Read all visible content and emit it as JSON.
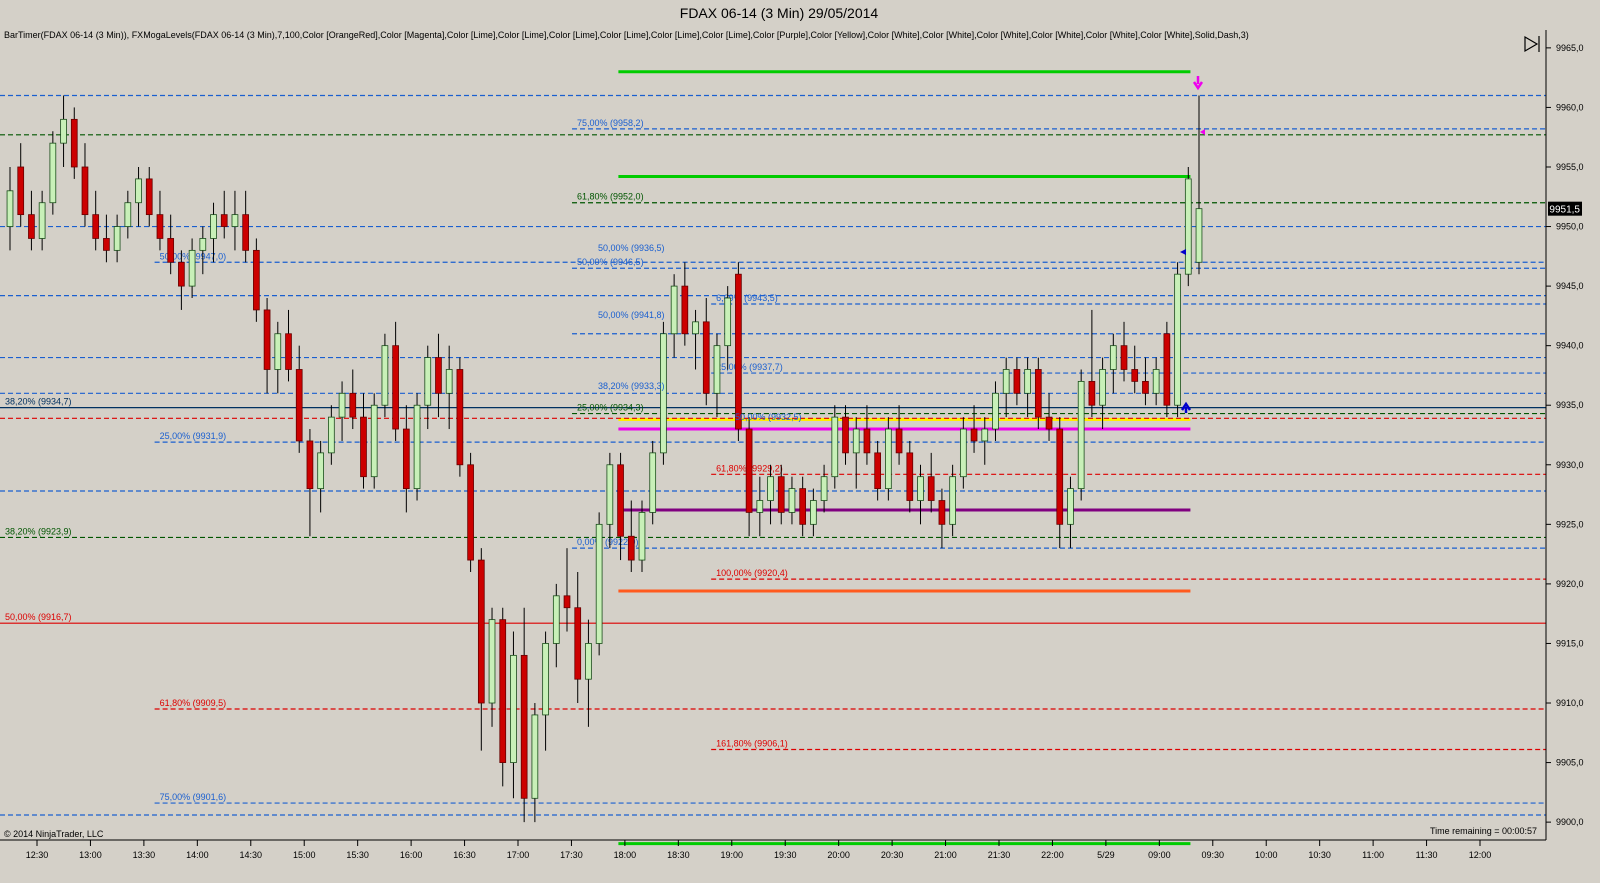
{
  "window": {
    "title": "FDAX 06-14 (3 Min)  29/05/2014"
  },
  "indicator_text": "BarTimer(FDAX 06-14 (3 Min)), FXMogaLevels(FDAX 06-14 (3 Min),7,100,Color [OrangeRed],Color [Magenta],Color [Lime],Color [Lime],Color [Lime],Color [Lime],Color [Lime],Color [Lime],Color [Purple],Color [Yellow],Color [White],Color [White],Color [White],Color [White],Color [White],Color [White],Solid,Dash,3)",
  "copyright": "© 2014 NinjaTrader, LLC",
  "time_remaining": "Time remaining = 00:00:57",
  "last_price": "9951,5",
  "colors": {
    "background": "#d4d0c8",
    "up_candle": "#c8f0b8",
    "down_candle": "#cc0000",
    "wick": "#000000",
    "lime": "#00cc00",
    "orange_red": "#ff5a1e",
    "magenta": "#ee00ee",
    "purple": "#800080",
    "yellow": "#ffee00",
    "blue_dash": "#1a5fd0",
    "red_dash": "#dd0000",
    "green_dash": "#005500",
    "navy": "#003060"
  },
  "chart_data": {
    "type": "candlestick",
    "title": "FDAX 06-14 (3 Min)  29/05/2014",
    "ylim": [
      9898.5,
      9966.5
    ],
    "y_ticks": [
      9900,
      9905,
      9910,
      9915,
      9920,
      9925,
      9930,
      9935,
      9940,
      9945,
      9950,
      9955,
      9960,
      9965
    ],
    "y_tick_labels": [
      "9900,0",
      "9905,0",
      "9910,0",
      "9915,0",
      "9920,0",
      "9925,0",
      "9930,0",
      "9935,0",
      "9940,0",
      "9945,0",
      "9950,0",
      "9955,0",
      "9960,0",
      "9965,0"
    ],
    "x_tick_labels": [
      "12:30",
      "13:00",
      "13:30",
      "14:00",
      "14:30",
      "15:00",
      "15:30",
      "16:00",
      "16:30",
      "17:00",
      "17:30",
      "18:00",
      "18:30",
      "19:00",
      "19:30",
      "20:00",
      "20:30",
      "21:00",
      "21:30",
      "22:00",
      "5/29",
      "09:00",
      "09:30",
      "10:00",
      "10:30",
      "11:00",
      "11:30",
      "12:00"
    ],
    "candles": [
      {
        "x": 0,
        "o": 9950,
        "h": 9955,
        "l": 9948,
        "c": 9953
      },
      {
        "x": 1,
        "o": 9955,
        "h": 9957,
        "l": 9950,
        "c": 9951
      },
      {
        "x": 2,
        "o": 9951,
        "h": 9953,
        "l": 9948,
        "c": 9949
      },
      {
        "x": 3,
        "o": 9949,
        "h": 9953,
        "l": 9948,
        "c": 9952
      },
      {
        "x": 4,
        "o": 9952,
        "h": 9958,
        "l": 9951,
        "c": 9957
      },
      {
        "x": 5,
        "o": 9957,
        "h": 9961,
        "l": 9955,
        "c": 9959
      },
      {
        "x": 6,
        "o": 9959,
        "h": 9960,
        "l": 9954,
        "c": 9955
      },
      {
        "x": 7,
        "o": 9955,
        "h": 9957,
        "l": 9950,
        "c": 9951
      },
      {
        "x": 8,
        "o": 9951,
        "h": 9953,
        "l": 9948,
        "c": 9949
      },
      {
        "x": 9,
        "o": 9949,
        "h": 9951,
        "l": 9947,
        "c": 9948
      },
      {
        "x": 10,
        "o": 9948,
        "h": 9951,
        "l": 9947,
        "c": 9950
      },
      {
        "x": 11,
        "o": 9950,
        "h": 9953,
        "l": 9949,
        "c": 9952
      },
      {
        "x": 12,
        "o": 9952,
        "h": 9955,
        "l": 9950,
        "c": 9954
      },
      {
        "x": 13,
        "o": 9954,
        "h": 9955,
        "l": 9950,
        "c": 9951
      },
      {
        "x": 14,
        "o": 9951,
        "h": 9953,
        "l": 9948,
        "c": 9949
      },
      {
        "x": 15,
        "o": 9949,
        "h": 9951,
        "l": 9946,
        "c": 9947
      },
      {
        "x": 16,
        "o": 9947,
        "h": 9948,
        "l": 9943,
        "c": 9945
      },
      {
        "x": 17,
        "o": 9945,
        "h": 9949,
        "l": 9944,
        "c": 9948
      },
      {
        "x": 18,
        "o": 9948,
        "h": 9950,
        "l": 9946,
        "c": 9949
      },
      {
        "x": 19,
        "o": 9949,
        "h": 9952,
        "l": 9947,
        "c": 9951
      },
      {
        "x": 20,
        "o": 9951,
        "h": 9953,
        "l": 9949,
        "c": 9950
      },
      {
        "x": 21,
        "o": 9950,
        "h": 9953,
        "l": 9948,
        "c": 9951
      },
      {
        "x": 22,
        "o": 9951,
        "h": 9953,
        "l": 9947,
        "c": 9948
      },
      {
        "x": 23,
        "o": 9948,
        "h": 9949,
        "l": 9942,
        "c": 9943
      },
      {
        "x": 24,
        "o": 9943,
        "h": 9944,
        "l": 9936,
        "c": 9938
      },
      {
        "x": 25,
        "o": 9938,
        "h": 9942,
        "l": 9936,
        "c": 9941
      },
      {
        "x": 26,
        "o": 9941,
        "h": 9943,
        "l": 9937,
        "c": 9938
      },
      {
        "x": 27,
        "o": 9938,
        "h": 9940,
        "l": 9931,
        "c": 9932
      },
      {
        "x": 28,
        "o": 9932,
        "h": 9933,
        "l": 9924,
        "c": 9928
      },
      {
        "x": 29,
        "o": 9928,
        "h": 9932,
        "l": 9926,
        "c": 9931
      },
      {
        "x": 30,
        "o": 9931,
        "h": 9935,
        "l": 9930,
        "c": 9934
      },
      {
        "x": 31,
        "o": 9934,
        "h": 9937,
        "l": 9932,
        "c": 9936
      },
      {
        "x": 32,
        "o": 9936,
        "h": 9938,
        "l": 9933,
        "c": 9934
      },
      {
        "x": 33,
        "o": 9934,
        "h": 9936,
        "l": 9928,
        "c": 9929
      },
      {
        "x": 34,
        "o": 9929,
        "h": 9936,
        "l": 9928,
        "c": 9935
      },
      {
        "x": 35,
        "o": 9935,
        "h": 9941,
        "l": 9934,
        "c": 9940
      },
      {
        "x": 36,
        "o": 9940,
        "h": 9942,
        "l": 9932,
        "c": 9933
      },
      {
        "x": 37,
        "o": 9933,
        "h": 9935,
        "l": 9926,
        "c": 9928
      },
      {
        "x": 38,
        "o": 9928,
        "h": 9936,
        "l": 9927,
        "c": 9935
      },
      {
        "x": 39,
        "o": 9935,
        "h": 9940,
        "l": 9933,
        "c": 9939
      },
      {
        "x": 40,
        "o": 9939,
        "h": 9941,
        "l": 9934,
        "c": 9936
      },
      {
        "x": 41,
        "o": 9936,
        "h": 9940,
        "l": 9933,
        "c": 9938
      },
      {
        "x": 42,
        "o": 9938,
        "h": 9939,
        "l": 9929,
        "c": 9930
      },
      {
        "x": 43,
        "o": 9930,
        "h": 9931,
        "l": 9921,
        "c": 9922
      },
      {
        "x": 44,
        "o": 9922,
        "h": 9923,
        "l": 9906,
        "c": 9910
      },
      {
        "x": 45,
        "o": 9910,
        "h": 9918,
        "l": 9908,
        "c": 9917
      },
      {
        "x": 46,
        "o": 9917,
        "h": 9918,
        "l": 9903,
        "c": 9905
      },
      {
        "x": 47,
        "o": 9905,
        "h": 9916,
        "l": 9902,
        "c": 9914
      },
      {
        "x": 48,
        "o": 9914,
        "h": 9918,
        "l": 9900,
        "c": 9902
      },
      {
        "x": 49,
        "o": 9902,
        "h": 9910,
        "l": 9900,
        "c": 9909
      },
      {
        "x": 50,
        "o": 9909,
        "h": 9916,
        "l": 9906,
        "c": 9915
      },
      {
        "x": 51,
        "o": 9915,
        "h": 9920,
        "l": 9913,
        "c": 9919
      },
      {
        "x": 52,
        "o": 9919,
        "h": 9923,
        "l": 9916,
        "c": 9918
      },
      {
        "x": 53,
        "o": 9918,
        "h": 9921,
        "l": 9910,
        "c": 9912
      },
      {
        "x": 54,
        "o": 9912,
        "h": 9917,
        "l": 9908,
        "c": 9915
      },
      {
        "x": 55,
        "o": 9915,
        "h": 9926,
        "l": 9914,
        "c": 9925
      },
      {
        "x": 56,
        "o": 9925,
        "h": 9931,
        "l": 9923,
        "c": 9930
      },
      {
        "x": 57,
        "o": 9930,
        "h": 9931,
        "l": 9922,
        "c": 9924
      },
      {
        "x": 58,
        "o": 9924,
        "h": 9927,
        "l": 9921,
        "c": 9922
      },
      {
        "x": 59,
        "o": 9922,
        "h": 9927,
        "l": 9921,
        "c": 9926
      },
      {
        "x": 60,
        "o": 9926,
        "h": 9932,
        "l": 9925,
        "c": 9931
      },
      {
        "x": 61,
        "o": 9931,
        "h": 9942,
        "l": 9930,
        "c": 9941
      },
      {
        "x": 62,
        "o": 9941,
        "h": 9946,
        "l": 9939,
        "c": 9945
      },
      {
        "x": 63,
        "o": 9945,
        "h": 9947,
        "l": 9940,
        "c": 9941
      },
      {
        "x": 64,
        "o": 9941,
        "h": 9943,
        "l": 9938,
        "c": 9942
      },
      {
        "x": 65,
        "o": 9942,
        "h": 9944,
        "l": 9935,
        "c": 9936
      },
      {
        "x": 66,
        "o": 9936,
        "h": 9941,
        "l": 9934,
        "c": 9940
      },
      {
        "x": 67,
        "o": 9940,
        "h": 9945,
        "l": 9938,
        "c": 9944
      },
      {
        "x": 68,
        "o": 9946,
        "h": 9947,
        "l": 9932,
        "c": 9933
      },
      {
        "x": 69,
        "o": 9933,
        "h": 9934,
        "l": 9924,
        "c": 9926
      },
      {
        "x": 70,
        "o": 9926,
        "h": 9929,
        "l": 9924,
        "c": 9927
      },
      {
        "x": 71,
        "o": 9927,
        "h": 9930,
        "l": 9925,
        "c": 9929
      },
      {
        "x": 72,
        "o": 9929,
        "h": 9930,
        "l": 9925,
        "c": 9926
      },
      {
        "x": 73,
        "o": 9926,
        "h": 9929,
        "l": 9925,
        "c": 9928
      },
      {
        "x": 74,
        "o": 9928,
        "h": 9929,
        "l": 9924,
        "c": 9925
      },
      {
        "x": 75,
        "o": 9925,
        "h": 9928,
        "l": 9924,
        "c": 9927
      },
      {
        "x": 76,
        "o": 9927,
        "h": 9930,
        "l": 9926,
        "c": 9929
      },
      {
        "x": 77,
        "o": 9929,
        "h": 9935,
        "l": 9928,
        "c": 9934
      },
      {
        "x": 78,
        "o": 9934,
        "h": 9935,
        "l": 9930,
        "c": 9931
      },
      {
        "x": 79,
        "o": 9931,
        "h": 9934,
        "l": 9928,
        "c": 9933
      },
      {
        "x": 80,
        "o": 9933,
        "h": 9935,
        "l": 9930,
        "c": 9931
      },
      {
        "x": 81,
        "o": 9931,
        "h": 9932,
        "l": 9927,
        "c": 9928
      },
      {
        "x": 82,
        "o": 9928,
        "h": 9934,
        "l": 9927,
        "c": 9933
      },
      {
        "x": 83,
        "o": 9933,
        "h": 9935,
        "l": 9930,
        "c": 9931
      },
      {
        "x": 84,
        "o": 9931,
        "h": 9932,
        "l": 9926,
        "c": 9927
      },
      {
        "x": 85,
        "o": 9927,
        "h": 9930,
        "l": 9925,
        "c": 9929
      },
      {
        "x": 86,
        "o": 9929,
        "h": 9931,
        "l": 9926,
        "c": 9927
      },
      {
        "x": 87,
        "o": 9927,
        "h": 9928,
        "l": 9923,
        "c": 9925
      },
      {
        "x": 88,
        "o": 9925,
        "h": 9930,
        "l": 9924,
        "c": 9929
      },
      {
        "x": 89,
        "o": 9929,
        "h": 9934,
        "l": 9928,
        "c": 9933
      },
      {
        "x": 90,
        "o": 9933,
        "h": 9935,
        "l": 9931,
        "c": 9932
      },
      {
        "x": 91,
        "o": 9932,
        "h": 9934,
        "l": 9930,
        "c": 9933
      },
      {
        "x": 92,
        "o": 9933,
        "h": 9937,
        "l": 9932,
        "c": 9936
      },
      {
        "x": 93,
        "o": 9936,
        "h": 9939,
        "l": 9934,
        "c": 9938
      },
      {
        "x": 94,
        "o": 9938,
        "h": 9939,
        "l": 9935,
        "c": 9936
      },
      {
        "x": 95,
        "o": 9936,
        "h": 9939,
        "l": 9934,
        "c": 9938
      },
      {
        "x": 96,
        "o": 9938,
        "h": 9939,
        "l": 9933,
        "c": 9934
      },
      {
        "x": 97,
        "o": 9934,
        "h": 9936,
        "l": 9932,
        "c": 9933
      },
      {
        "x": 98,
        "o": 9933,
        "h": 9934,
        "l": 9923,
        "c": 9925
      },
      {
        "x": 99,
        "o": 9925,
        "h": 9929,
        "l": 9923,
        "c": 9928
      },
      {
        "x": 100,
        "o": 9928,
        "h": 9938,
        "l": 9927,
        "c": 9937
      },
      {
        "x": 101,
        "o": 9937,
        "h": 9943,
        "l": 9934,
        "c": 9935
      },
      {
        "x": 102,
        "o": 9935,
        "h": 9939,
        "l": 9933,
        "c": 9938
      },
      {
        "x": 103,
        "o": 9938,
        "h": 9941,
        "l": 9936,
        "c": 9940
      },
      {
        "x": 104,
        "o": 9940,
        "h": 9942,
        "l": 9937,
        "c": 9938
      },
      {
        "x": 105,
        "o": 9938,
        "h": 9940,
        "l": 9936,
        "c": 9937
      },
      {
        "x": 106,
        "o": 9937,
        "h": 9939,
        "l": 9935,
        "c": 9936
      },
      {
        "x": 107,
        "o": 9936,
        "h": 9939,
        "l": 9935,
        "c": 9938
      },
      {
        "x": 108,
        "o": 9941,
        "h": 9942,
        "l": 9934,
        "c": 9935
      },
      {
        "x": 109,
        "o": 9935,
        "h": 9947,
        "l": 9934,
        "c": 9946
      },
      {
        "x": 110,
        "o": 9946,
        "h": 9955,
        "l": 9945,
        "c": 9954
      },
      {
        "x": 111,
        "o": 9947,
        "h": 9961,
        "l": 9946,
        "c": 9951.5
      }
    ],
    "levels": [
      {
        "price": 9963,
        "label": "",
        "style": "solid",
        "color": "lime",
        "from": 0.4,
        "to": 0.77
      },
      {
        "price": 9954.2,
        "label": "",
        "style": "solid",
        "color": "lime",
        "from": 0.4,
        "to": 0.77
      },
      {
        "price": 9898.2,
        "label": "",
        "style": "solid",
        "color": "lime",
        "from": 0.4,
        "to": 0.77
      },
      {
        "price": 9919.4,
        "label": "",
        "style": "solid",
        "color": "orange_red",
        "from": 0.4,
        "to": 0.77
      },
      {
        "price": 9933.0,
        "label": "",
        "style": "solid",
        "color": "magenta",
        "from": 0.4,
        "to": 0.77
      },
      {
        "price": 9933.8,
        "label": "",
        "style": "solid",
        "color": "yellow",
        "from": 0.4,
        "to": 0.77
      },
      {
        "price": 9926.2,
        "label": "",
        "style": "solid",
        "color": "purple",
        "from": 0.4,
        "to": 0.77
      },
      {
        "price": 9916.7,
        "label": "50,00% (9916,7)",
        "style": "solid",
        "color": "red_dash",
        "from": 0.0,
        "to": 1.0
      },
      {
        "price": 9934.8,
        "label": "38,20% (9934,7)",
        "style": "solid",
        "color": "navy",
        "from": 0.0,
        "to": 1.0
      },
      {
        "price": 9961.0,
        "label": "",
        "style": "dash",
        "color": "blue_dash",
        "from": 0.0,
        "to": 1.0
      },
      {
        "price": 9958.2,
        "label": "75,00% (9958,2)",
        "style": "dash",
        "color": "blue_dash",
        "from": 0.37,
        "to": 1.0
      },
      {
        "price": 9957.7,
        "label": "",
        "style": "dash",
        "color": "green_dash",
        "from": 0.0,
        "to": 1.0
      },
      {
        "price": 9952.0,
        "label": "61,80% (9952,0)",
        "style": "dash",
        "color": "green_dash",
        "from": 0.37,
        "to": 1.0
      },
      {
        "price": 9950.0,
        "label": "",
        "style": "dash",
        "color": "blue_dash",
        "from": 0.0,
        "to": 1.0
      },
      {
        "price": 9947.0,
        "label": "50,00% (9947,0)",
        "style": "dash",
        "color": "blue_dash",
        "from": 0.1,
        "to": 1.0
      },
      {
        "price": 9946.5,
        "label": "50,00% (9946,5)",
        "style": "dash",
        "color": "blue_dash",
        "from": 0.37,
        "to": 1.0
      },
      {
        "price": 9944.2,
        "label": "",
        "style": "dash",
        "color": "blue_dash",
        "from": 0.0,
        "to": 1.0
      },
      {
        "price": 9943.5,
        "label": "6,69% (9943,5)",
        "style": "dash",
        "color": "blue_dash",
        "from": 0.46,
        "to": 1.0
      },
      {
        "price": 9941.0,
        "label": "",
        "style": "dash",
        "color": "blue_dash",
        "from": 0.37,
        "to": 1.0
      },
      {
        "price": 9939.0,
        "label": "",
        "style": "dash",
        "color": "blue_dash",
        "from": 0.0,
        "to": 1.0
      },
      {
        "price": 9937.7,
        "label": "25,00% (9937,7)",
        "style": "dash",
        "color": "blue_dash",
        "from": 0.46,
        "to": 1.0
      },
      {
        "price": 9936.0,
        "label": "",
        "style": "dash",
        "color": "blue_dash",
        "from": 0.0,
        "to": 1.0
      },
      {
        "price": 9934.3,
        "label": "25,00% (9934,3)",
        "style": "dash",
        "color": "green_dash",
        "from": 0.37,
        "to": 1.0
      },
      {
        "price": 9933.9,
        "label": "",
        "style": "dash",
        "color": "red_dash",
        "from": 0.0,
        "to": 1.0
      },
      {
        "price": 9931.9,
        "label": "25,00% (9931,9)",
        "style": "dash",
        "color": "blue_dash",
        "from": 0.1,
        "to": 1.0
      },
      {
        "price": 9929.2,
        "label": "61,80% (9929,2)",
        "style": "dash",
        "color": "red_dash",
        "from": 0.46,
        "to": 1.0
      },
      {
        "price": 9927.8,
        "label": "",
        "style": "dash",
        "color": "blue_dash",
        "from": 0.0,
        "to": 1.0
      },
      {
        "price": 9923.9,
        "label": "38,20% (9923,9)",
        "style": "dash",
        "color": "green_dash",
        "from": 0.0,
        "to": 1.0
      },
      {
        "price": 9923.0,
        "label": "0,00% (9922,9)",
        "style": "dash",
        "color": "blue_dash",
        "from": 0.37,
        "to": 1.0
      },
      {
        "price": 9920.4,
        "label": "100,00% (9920,4)",
        "style": "dash",
        "color": "red_dash",
        "from": 0.46,
        "to": 1.0
      },
      {
        "price": 9909.5,
        "label": "61,80% (9909,5)",
        "style": "dash",
        "color": "red_dash",
        "from": 0.1,
        "to": 1.0
      },
      {
        "price": 9906.1,
        "label": "161,80% (9906,1)",
        "style": "dash",
        "color": "red_dash",
        "from": 0.46,
        "to": 1.0
      },
      {
        "price": 9901.6,
        "label": "75,00% (9901,6)",
        "style": "dash",
        "color": "blue_dash",
        "from": 0.1,
        "to": 1.0
      },
      {
        "price": 9900.6,
        "label": "",
        "style": "dash",
        "color": "blue_dash",
        "from": 0.0,
        "to": 1.0
      }
    ],
    "marker_labels": [
      "50,00% (9936,5)",
      "38,20% (9933,3)",
      "50,00% (9932,5)",
      "50,00% (9941,8)"
    ],
    "grid": false,
    "legend": "none"
  }
}
